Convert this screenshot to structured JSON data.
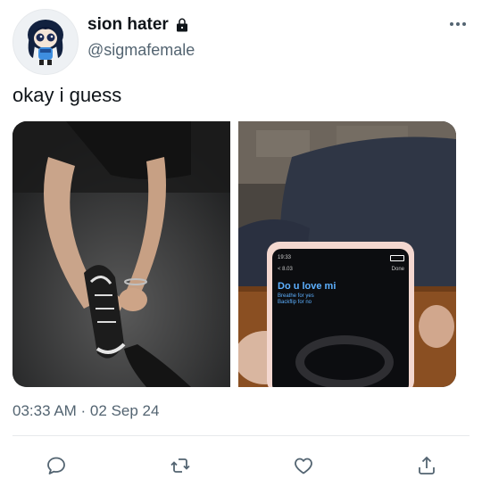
{
  "author": {
    "display_name": "sion hater",
    "handle": "@sigmafemale",
    "lock_icon": "lock-icon"
  },
  "tweet": {
    "text": "okay i guess",
    "timestamp": "03:33 AM · 02 Sep 24"
  },
  "phone_screen": {
    "time": "19:33",
    "done_label": "Done",
    "back_label": "< 8.03",
    "title": "Do u love mi",
    "line1": "Breathe for yes",
    "line2": "Backflip for no"
  },
  "actions": [
    {
      "icon": "reply-icon"
    },
    {
      "icon": "retweet-icon"
    },
    {
      "icon": "like-icon"
    },
    {
      "icon": "share-icon"
    }
  ],
  "colors": {
    "text": "#0f1419",
    "secondary": "#536471",
    "divider": "#e6e9ec"
  }
}
